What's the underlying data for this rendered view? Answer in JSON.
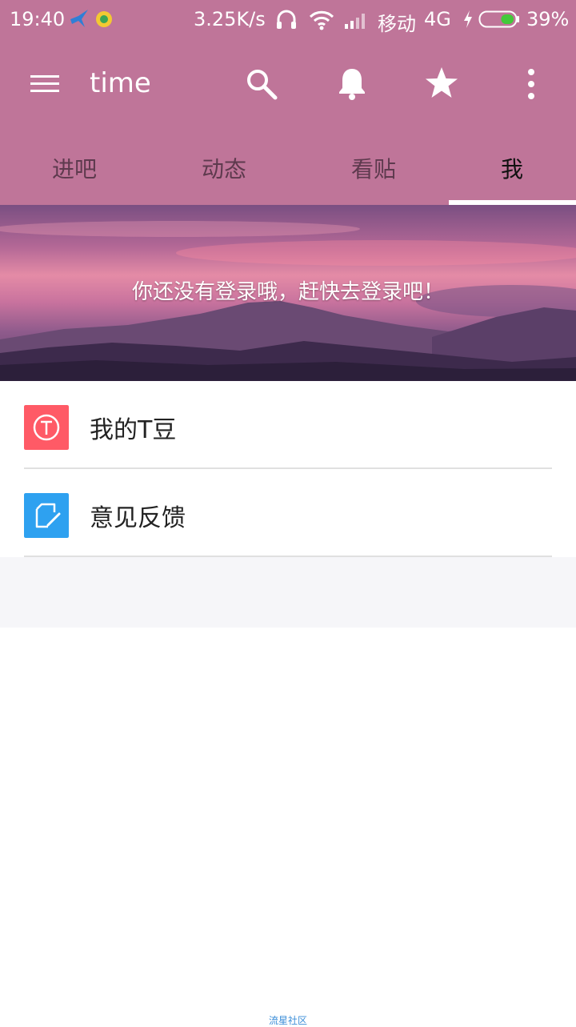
{
  "status_bar": {
    "time": "19:40",
    "net_speed": "3.25K/s",
    "carrier": "移动",
    "network": "4G",
    "battery": "39%",
    "battery_level": 0.39,
    "icons": [
      "bird-app-icon",
      "app-badge-icon",
      "headset-icon",
      "wifi-icon",
      "signal-icon",
      "charging-bolt-icon",
      "battery-icon"
    ]
  },
  "toolbar": {
    "title": "time",
    "icons": [
      "menu-icon",
      "search-icon",
      "bell-icon",
      "star-icon",
      "more-icon"
    ]
  },
  "tabs": [
    {
      "label": "进吧",
      "active": false
    },
    {
      "label": "动态",
      "active": false
    },
    {
      "label": "看贴",
      "active": false
    },
    {
      "label": "我",
      "active": true
    }
  ],
  "banner": {
    "prompt": "你还没有登录哦，赶快去登录吧！"
  },
  "menu": [
    {
      "label": "我的T豆",
      "icon": "t-coin-icon",
      "color": "#ff5a66"
    },
    {
      "label": "意见反馈",
      "icon": "feedback-edit-icon",
      "color": "#2ea1f0"
    }
  ],
  "watermark": "流星社区",
  "colors": {
    "accent": "#bf7599",
    "tab_indicator": "#ffffff"
  }
}
